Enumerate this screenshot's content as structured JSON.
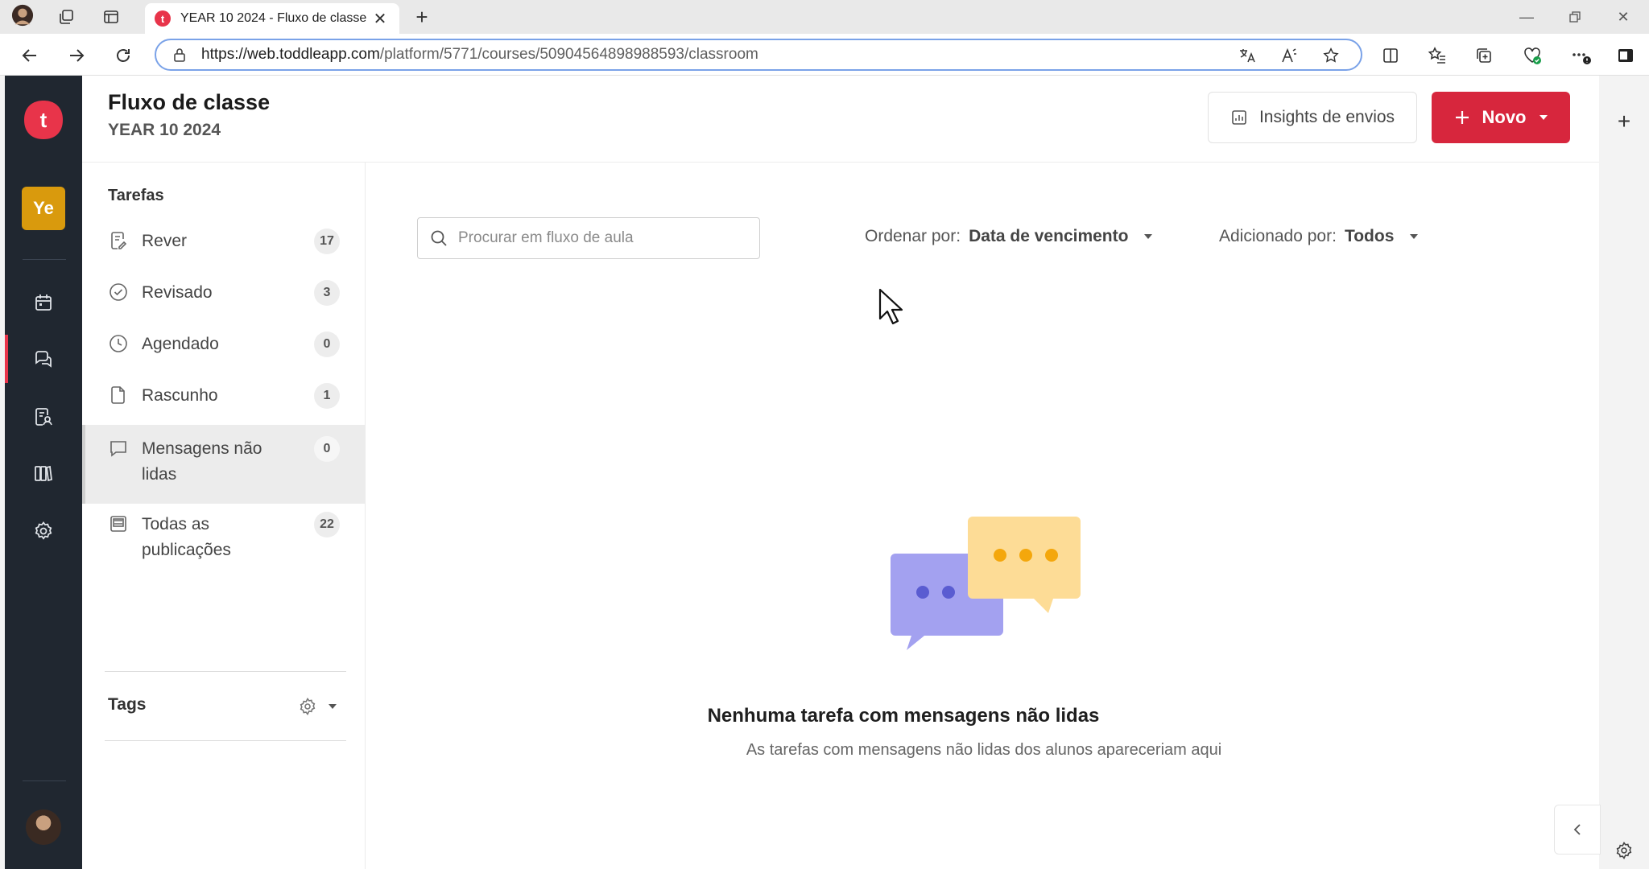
{
  "browser": {
    "tab_title": "YEAR 10 2024 - Fluxo de classe",
    "url_host": "https://web.toddleapp.com",
    "url_path": "/platform/5771/courses/50904564898988593/classroom"
  },
  "app": {
    "logo_letter": "t",
    "class_badge": "Ye"
  },
  "header": {
    "title": "Fluxo de classe",
    "subtitle": "YEAR 10 2024",
    "insights_label": "Insights de envios",
    "new_label": "Novo"
  },
  "sidebar": {
    "heading": "Tarefas",
    "items": [
      {
        "label": "Rever",
        "count": "17"
      },
      {
        "label": "Revisado",
        "count": "3"
      },
      {
        "label": "Agendado",
        "count": "0"
      },
      {
        "label": "Rascunho",
        "count": "1"
      },
      {
        "label": "Mensagens não lidas",
        "count": "0"
      },
      {
        "label": "Todas as publicações",
        "count": "22"
      }
    ],
    "tags_label": "Tags"
  },
  "content": {
    "search_placeholder": "Procurar em fluxo de aula",
    "sort_label": "Ordenar por:",
    "sort_value": "Data de vencimento",
    "added_label": "Adicionado por:",
    "added_value": "Todos",
    "empty_title": "Nenhuma tarefa com mensagens não lidas",
    "empty_subtitle": "As tarefas com mensagens não lidas dos alunos apareceriam aqui"
  },
  "colors": {
    "brand_red": "#d7263d",
    "rail_bg": "#202730",
    "badge_amber": "#d99a0d"
  }
}
